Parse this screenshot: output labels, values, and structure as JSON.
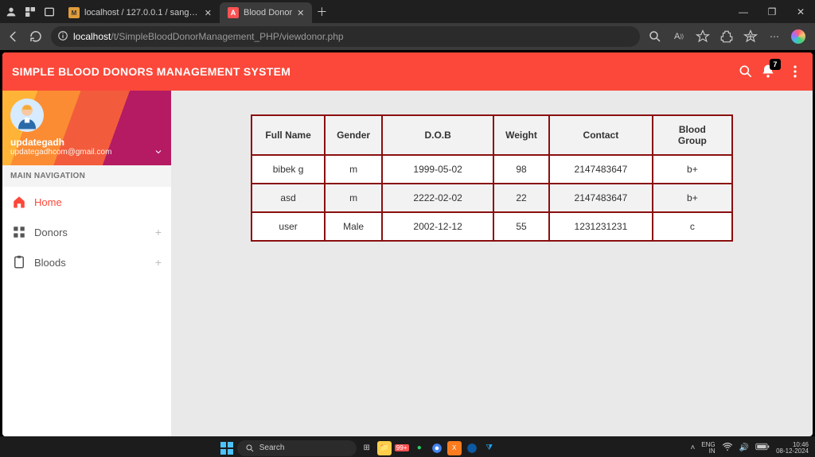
{
  "browser": {
    "tabs": [
      {
        "title": "localhost / 127.0.0.1 / sangamdb",
        "favicon": "php"
      },
      {
        "title": "Blood Donor",
        "favicon": "app",
        "active": true
      }
    ],
    "url_host": "localhost",
    "url_path": "/t/SimpleBloodDonorManagement_PHP/viewdonor.php"
  },
  "app": {
    "title": "SIMPLE BLOOD DONORS MANAGEMENT SYSTEM",
    "notification_count": "7",
    "user": {
      "name": "updategadh",
      "email": "updategadhcom@gmail.com"
    },
    "nav_label": "MAIN NAVIGATION",
    "nav": [
      {
        "icon": "home",
        "label": "Home",
        "active": true,
        "expandable": false
      },
      {
        "icon": "grid",
        "label": "Donors",
        "active": false,
        "expandable": true
      },
      {
        "icon": "clipboard",
        "label": "Bloods",
        "active": false,
        "expandable": true
      }
    ],
    "table": {
      "headers": [
        "Full Name",
        "Gender",
        "D.O.B",
        "Weight",
        "Contact",
        "Blood Group"
      ],
      "rows": [
        [
          "bibek g",
          "m",
          "1999-05-02",
          "98",
          "2147483647",
          "b+"
        ],
        [
          "asd",
          "m",
          "2222-02-02",
          "22",
          "2147483647",
          "b+"
        ],
        [
          "user",
          "Male",
          "2002-12-12",
          "55",
          "1231231231",
          "c"
        ]
      ]
    }
  },
  "taskbar": {
    "search_placeholder": "Search",
    "badge": "99+",
    "lang1": "ENG",
    "lang2": "IN",
    "time": "10:46",
    "date": "08-12-2024"
  }
}
